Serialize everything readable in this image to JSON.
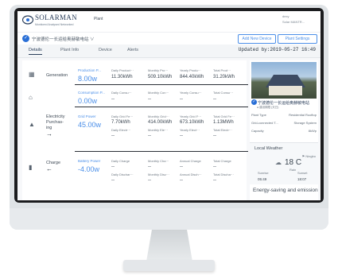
{
  "header": {
    "brand": "SOLARMAN",
    "brand_sub": "Monitored Analysed Networked",
    "plant_menu": "Plant",
    "user_line1": "dexy",
    "user_line2": "Solar MANTR..."
  },
  "plant_bar": {
    "plant_name": "宁波德伦一长运给奥赫敏电站 ∨",
    "add_device": "Add New Device",
    "plant_settings": "Plant Settings"
  },
  "tabs": [
    "Details",
    "Plant Info",
    "Device",
    "Alerts"
  ],
  "updated": "Updated by:2019-05-27 16:49",
  "rows": {
    "generation": {
      "label": "Generation",
      "big_label": "Production P...",
      "big_value": "8.00w",
      "cells": [
        {
          "label": "Daily Product···",
          "value": "11.30kWh"
        },
        {
          "label": "Monthly Pro···",
          "value": "509.10kWh"
        },
        {
          "label": "Yearly Produ···",
          "value": "844.40kWh"
        },
        {
          "label": "Total Prod···",
          "value": "31.20kWh"
        }
      ]
    },
    "consumption": {
      "big_label": "Consumption P...",
      "big_value": "0.00w",
      "cells": [
        {
          "label": "Daily Consu···",
          "value": "--"
        },
        {
          "label": "Monthly Con···",
          "value": "--"
        },
        {
          "label": "Yearly Consu···",
          "value": "--"
        },
        {
          "label": "Total Consu···",
          "value": "--"
        }
      ]
    },
    "grid": {
      "label_line1": "Electricity",
      "label_line2": "Purchas-",
      "label_line3": "ing",
      "big_label": "Grid Power",
      "big_value": "45.00w",
      "cells_top": [
        {
          "label": "Daily Grid Fe···",
          "value": "7.70kWh"
        },
        {
          "label": "Monthly Grid···",
          "value": "414.00kWh"
        },
        {
          "label": "Yearly Grid F···",
          "value": "673.10kWh"
        },
        {
          "label": "Total Grid Fe···",
          "value": "1.13MWh"
        }
      ],
      "cells_bottom": [
        {
          "label": "Daily Electr···",
          "value": "--"
        },
        {
          "label": "Monthly Ele···",
          "value": "--"
        },
        {
          "label": "Yearly Elect···",
          "value": "--"
        },
        {
          "label": "Total Electr···",
          "value": "--"
        }
      ]
    },
    "battery": {
      "label": "Charge",
      "big_label": "Battery Power",
      "big_value": "-4.00w",
      "cells_top": [
        {
          "label": "Daily Charge",
          "value": "--"
        },
        {
          "label": "Monthly Cha···",
          "value": "--"
        },
        {
          "label": "Annual Charge",
          "value": "--"
        },
        {
          "label": "Total Charge",
          "value": "--"
        }
      ],
      "cells_bottom": [
        {
          "label": "Daily Dischar···",
          "value": "--"
        },
        {
          "label": "Monthly Disc···",
          "value": "--"
        },
        {
          "label": "Annual Disch···",
          "value": "--"
        },
        {
          "label": "Total Discha···",
          "value": "--"
        }
      ]
    }
  },
  "side": {
    "title": "宁波德伦一长运给奥赫敏电站",
    "subtitle": "● 建设期限 (天日)",
    "plant_type_label": "Plant Type",
    "plant_type_value": "Residential Rooftop",
    "grid_label": "Grid-connected T...",
    "grid_value": "Storage System",
    "capacity_label": "Capacity",
    "capacity_value": "8kWp",
    "weather_title": "Local Weather",
    "city": "⚑ Ningbo",
    "temp": "18 C",
    "condition": "Rain",
    "sunrise_label": "Sunrise",
    "sunset_label": "Sunset",
    "sunrise": "05:49",
    "sunset": "18:07",
    "slogan": "Energy-saving and emission"
  }
}
